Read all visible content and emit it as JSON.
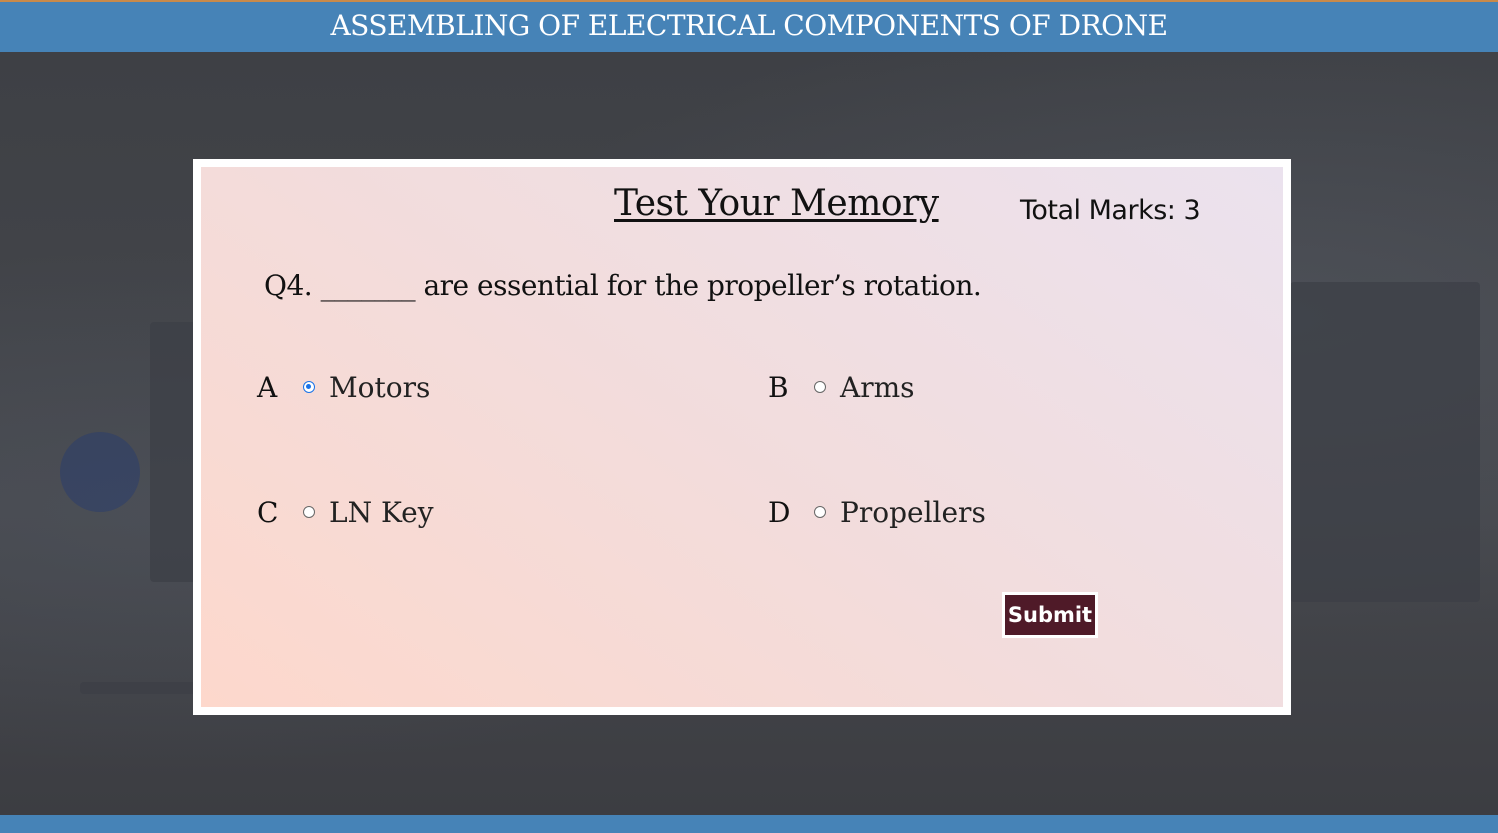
{
  "header": {
    "title": "ASSEMBLING OF ELECTRICAL COMPONENTS OF DRONE"
  },
  "quiz": {
    "title": "Test Your Memory",
    "total_marks_label": "Total Marks:",
    "total_marks_value": "3",
    "question": "Q4. _______ are essential for the propeller’s rotation.",
    "options": [
      {
        "letter": "A",
        "text": "Motors",
        "selected": true
      },
      {
        "letter": "B",
        "text": "Arms",
        "selected": false
      },
      {
        "letter": "C",
        "text": "LN Key",
        "selected": false
      },
      {
        "letter": "D",
        "text": "Propellers",
        "selected": false
      }
    ],
    "submit_label": "Submit"
  },
  "colors": {
    "header_bg": "#4683b7",
    "submit_bg": "#4f1a28",
    "radio_selected": "#1a73e8"
  }
}
